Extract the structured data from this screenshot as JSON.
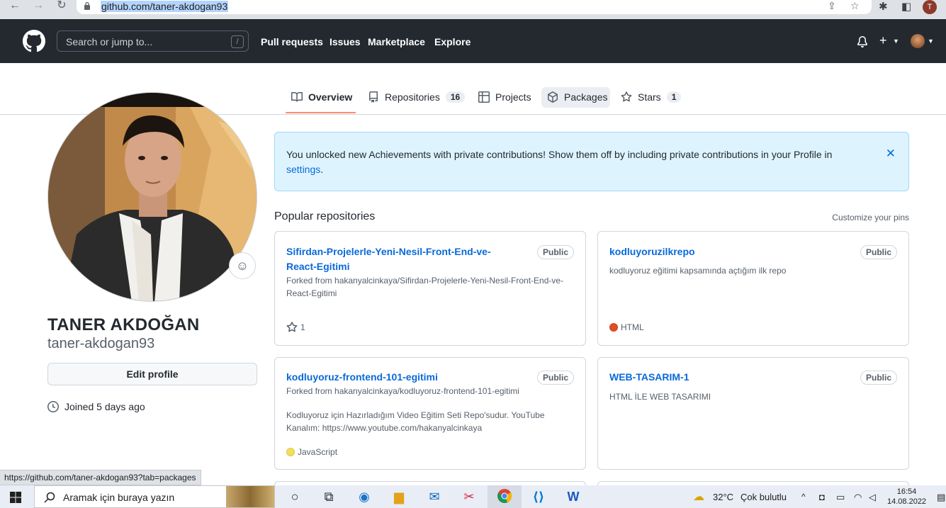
{
  "browser": {
    "url": "github.com/taner-akdogan93",
    "profile_initial": "T"
  },
  "header": {
    "search_placeholder": "Search or jump to...",
    "search_shortcut": "/",
    "nav": [
      "Pull requests",
      "Issues",
      "Marketplace",
      "Explore"
    ],
    "new_label": "+"
  },
  "tabs": [
    {
      "label": "Overview",
      "count": null
    },
    {
      "label": "Repositories",
      "count": "16"
    },
    {
      "label": "Projects",
      "count": null
    },
    {
      "label": "Packages",
      "count": null
    },
    {
      "label": "Stars",
      "count": "1"
    }
  ],
  "profile": {
    "full_name": "TANER AKDOĞAN",
    "username": "taner-akdogan93",
    "edit_button": "Edit profile",
    "joined": "Joined 5 days ago"
  },
  "flash": {
    "message": "You unlocked new Achievements with private contributions! Show them off by including private contributions in your Profile in",
    "link": "settings",
    "period": ".",
    "close": "✕"
  },
  "popular": {
    "title": "Popular repositories",
    "customize": "Customize your pins",
    "repos": [
      {
        "name": "Sifirdan-Projelerle-Yeni-Nesil-Front-End-ve-React-Egitimi",
        "visibility": "Public",
        "forked": "Forked from hakanyalcinkaya/Sifirdan-Projelerle-Yeni-Nesil-Front-End-ve-React-Egitimi",
        "description": "",
        "stars": "1",
        "language": "",
        "lang_color": ""
      },
      {
        "name": "kodluyoruzilkrepo",
        "visibility": "Public",
        "forked": "",
        "description": "kodluyoruz eğitimi kapsamında açtığım ilk repo",
        "stars": "",
        "language": "HTML",
        "lang_color": "#e34c26"
      },
      {
        "name": "kodluyoruz-frontend-101-egitimi",
        "visibility": "Public",
        "forked": "Forked from hakanyalcinkaya/kodluyoruz-frontend-101-egitimi",
        "description": "Kodluyoruz için Hazırladığım Video Eğitim Seti Repo'sudur. YouTube Kanalım: https://www.youtube.com/hakanyalcinkaya",
        "stars": "",
        "language": "JavaScript",
        "lang_color": "#f1e05a"
      },
      {
        "name": "WEB-TASARIM-1",
        "visibility": "Public",
        "forked": "",
        "description": "HTML İLE WEB TASARIMI",
        "stars": "",
        "language": "",
        "lang_color": ""
      }
    ]
  },
  "status_url": "https://github.com/taner-akdogan93?tab=packages",
  "taskbar": {
    "search_placeholder": "Aramak için buraya yazın",
    "temperature": "32°C",
    "weather": "Çok bulutlu",
    "time": "16:54",
    "date": "14.08.2022"
  }
}
